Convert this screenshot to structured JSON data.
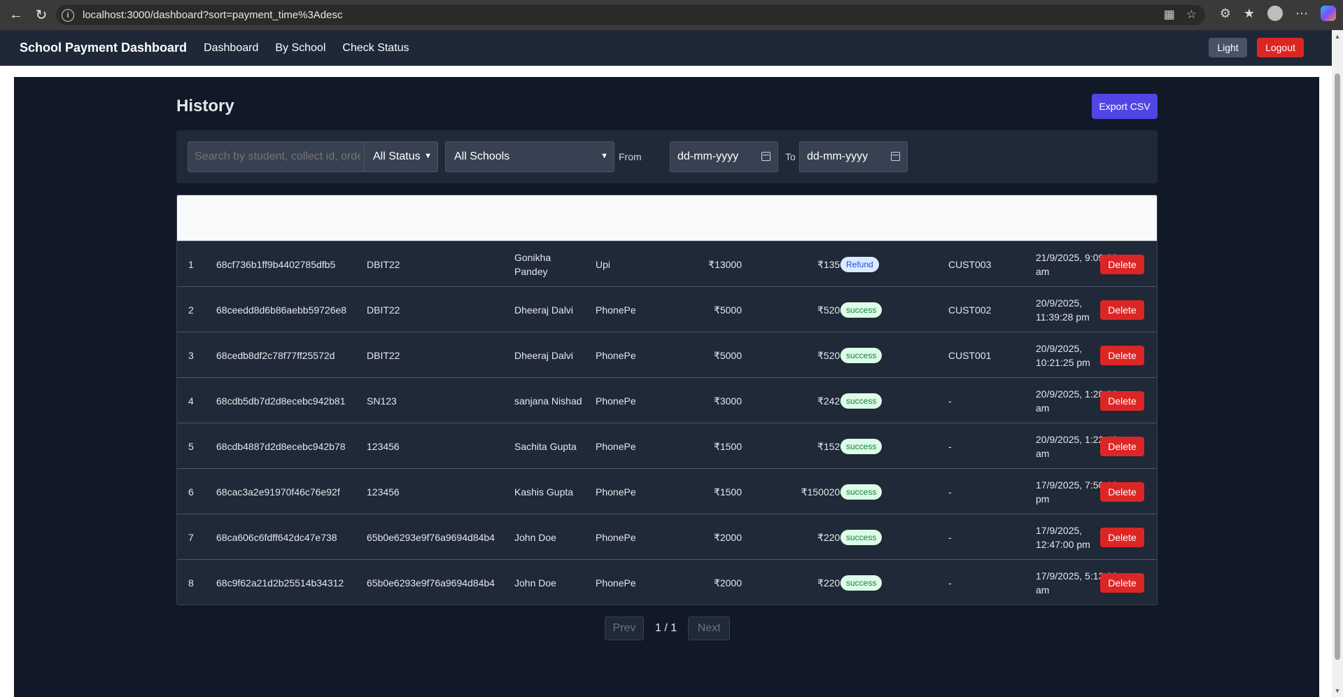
{
  "browser": {
    "url": "localhost:3000/dashboard?sort=payment_time%3Adesc"
  },
  "header": {
    "brand": "School Payment Dashboard",
    "nav": [
      "Dashboard",
      "By School",
      "Check Status"
    ],
    "theme_toggle": "Light",
    "logout": "Logout"
  },
  "page": {
    "title": "History",
    "export_label": "Export CSV"
  },
  "filters": {
    "search_placeholder": "Search by student, collect id, order",
    "status_select": "All Status",
    "school_select": "All Schools",
    "from_label": "From",
    "to_label": "To",
    "from_placeholder": "dd-mm-yyyy",
    "to_placeholder": "dd-mm-yyyy"
  },
  "table": {
    "delete_label": "Delete",
    "rows": [
      {
        "idx": "1",
        "collect_id": "68cf736b1ff9b4402785dfb5",
        "school": "DBIT22",
        "student": "Gonikha Pandey",
        "gateway": "Upi",
        "order_amount": "₹13000",
        "transaction_amount": "₹1350",
        "status": "Refund",
        "custom_id": "CUST003",
        "time": "21/9/2025, 9:09:23 am"
      },
      {
        "idx": "2",
        "collect_id": "68ceedd8d6b86aebb59726e8",
        "school": "DBIT22",
        "student": "Dheeraj Dalvi",
        "gateway": "PhonePe",
        "order_amount": "₹5000",
        "transaction_amount": "₹5200",
        "status": "success",
        "custom_id": "CUST002",
        "time": "20/9/2025, 11:39:28 pm"
      },
      {
        "idx": "3",
        "collect_id": "68cedb8df2c78f77ff25572d",
        "school": "DBIT22",
        "student": "Dheeraj Dalvi",
        "gateway": "PhonePe",
        "order_amount": "₹5000",
        "transaction_amount": "₹5200",
        "status": "success",
        "custom_id": "CUST001",
        "time": "20/9/2025, 10:21:25 pm"
      },
      {
        "idx": "4",
        "collect_id": "68cdb5db7d2d8ecebc942b81",
        "school": "SN123",
        "student": "sanjana Nishad",
        "gateway": "PhonePe",
        "order_amount": "₹3000",
        "transaction_amount": "₹2420",
        "status": "success",
        "custom_id": "-",
        "time": "20/9/2025, 1:28:22 am"
      },
      {
        "idx": "5",
        "collect_id": "68cdb4887d2d8ecebc942b78",
        "school": "123456",
        "student": "Sachita Gupta",
        "gateway": "PhonePe",
        "order_amount": "₹1500",
        "transaction_amount": "₹1520",
        "status": "success",
        "custom_id": "-",
        "time": "20/9/2025, 1:22:40 am"
      },
      {
        "idx": "6",
        "collect_id": "68cac3a2e91970f46c76e92f",
        "school": "123456",
        "student": "Kashis Gupta",
        "gateway": "PhonePe",
        "order_amount": "₹1500",
        "transaction_amount": "₹1500200",
        "status": "success",
        "custom_id": "-",
        "time": "17/9/2025, 7:50:18 pm"
      },
      {
        "idx": "7",
        "collect_id": "68ca606c6fdff642dc47e738",
        "school": "65b0e6293e9f76a9694d84b4",
        "student": "John Doe",
        "gateway": "PhonePe",
        "order_amount": "₹2000",
        "transaction_amount": "₹2200",
        "status": "success",
        "custom_id": "-",
        "time": "17/9/2025, 12:47:00 pm"
      },
      {
        "idx": "8",
        "collect_id": "68c9f62a21d2b25514b34312",
        "school": "65b0e6293e9f76a9694d84b4",
        "student": "John Doe",
        "gateway": "PhonePe",
        "order_amount": "₹2000",
        "transaction_amount": "₹2200",
        "status": "success",
        "custom_id": "-",
        "time": "17/9/2025, 5:13:38 am"
      }
    ]
  },
  "pagination": {
    "prev": "Prev",
    "page": "1 / 1",
    "next": "Next"
  },
  "colors": {
    "header_bg": "#1e2836",
    "main_bg": "#111827",
    "row_bg": "#1f2937",
    "accent": "#4f46e5",
    "danger": "#dc2626",
    "success_badge": "#dcfce7",
    "refund_badge": "#dbeafe"
  }
}
